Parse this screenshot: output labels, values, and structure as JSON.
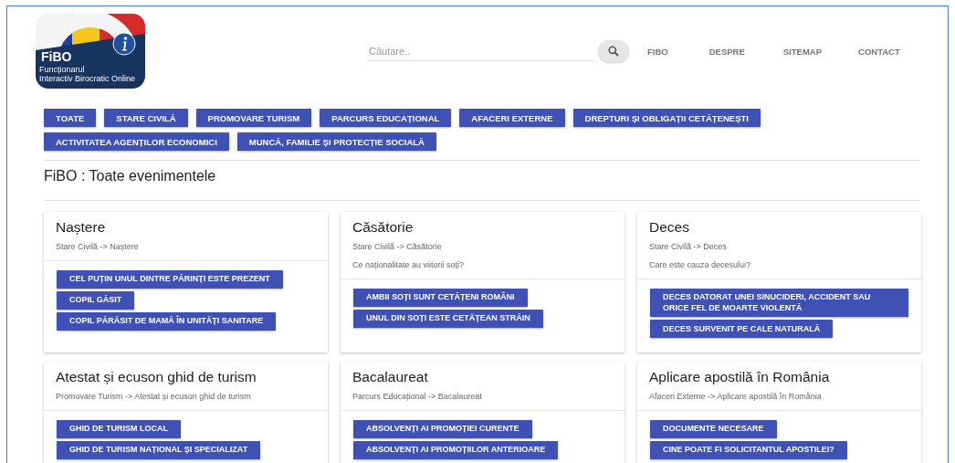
{
  "logo": {
    "name": "FiBO",
    "tagline": [
      "Funcționarul",
      "Interactiv Birocratic Online"
    ]
  },
  "search": {
    "placeholder": "Căutare.."
  },
  "nav": [
    "FIBO",
    "DESPRE",
    "SITEMAP",
    "CONTACT"
  ],
  "categories": [
    "TOATE",
    "STARE CIVILĂ",
    "PROMOVARE TURISM",
    "PARCURS EDUCAȚIONAL",
    "AFACERI EXTERNE",
    "DREPTURI ȘI OBLIGAȚII CETĂȚENEȘTI",
    "ACTIVITATEA AGENȚILOR ECONOMICI",
    "MUNCĂ, FAMILIE ȘI PROTECȚIE SOCIALĂ"
  ],
  "page_title": "FiBO : Toate evenimentele",
  "cards": [
    {
      "title": "Naștere",
      "breadcrumb": "Stare Civilă -> Naștere",
      "options": [
        "CEL PUȚIN UNUL DINTRE PĂRINȚI ESTE PREZENT",
        "COPIL GĂSIT",
        "COPIL PĂRĂSIT DE MAMĂ ÎN UNITĂȚI SANITARE"
      ]
    },
    {
      "title": "Căsătorie",
      "breadcrumb": "Stare Civilă -> Căsătorie",
      "question": "Ce naționalitate au viitorii soți?",
      "options": [
        "AMBII SOȚI SUNT CETĂȚENI ROMÂNI",
        "UNUL DIN SOȚI ESTE CETĂȚEAN STRĂIN"
      ]
    },
    {
      "title": "Deces",
      "breadcrumb": "Stare Civilă -> Deces",
      "question": "Care este cauza decesului?",
      "options": [
        "DECES DATORAT UNEI SINUCIDERI, ACCIDENT SAU ORICE FEL DE MOARTE VIOLENTĂ",
        "DECES SURVENIT PE CALE NATURALĂ"
      ]
    },
    {
      "title": "Atestat și ecuson ghid de turism",
      "breadcrumb": "Promovare Turism -> Atestat și ecuson ghid de turism",
      "options": [
        "GHID DE TURISM LOCAL",
        "GHID DE TURISM NAȚIONAL ȘI SPECIALIZAT"
      ]
    },
    {
      "title": "Bacalaureat",
      "breadcrumb": "Parcurs Educațional -> Bacalaureat",
      "options": [
        "ABSOLVENȚI AI PROMOȚIEI CURENTE",
        "ABSOLVENȚI AI PROMOȚIILOR ANTERIOARE"
      ]
    },
    {
      "title": "Aplicare apostilă în România",
      "breadcrumb": "Afaceri Externe -> Aplicare apostilă în România",
      "options": [
        "DOCUMENTE NECESARE",
        "CINE POATE FI SOLICITANTUL APOSTILEI?"
      ]
    }
  ]
}
